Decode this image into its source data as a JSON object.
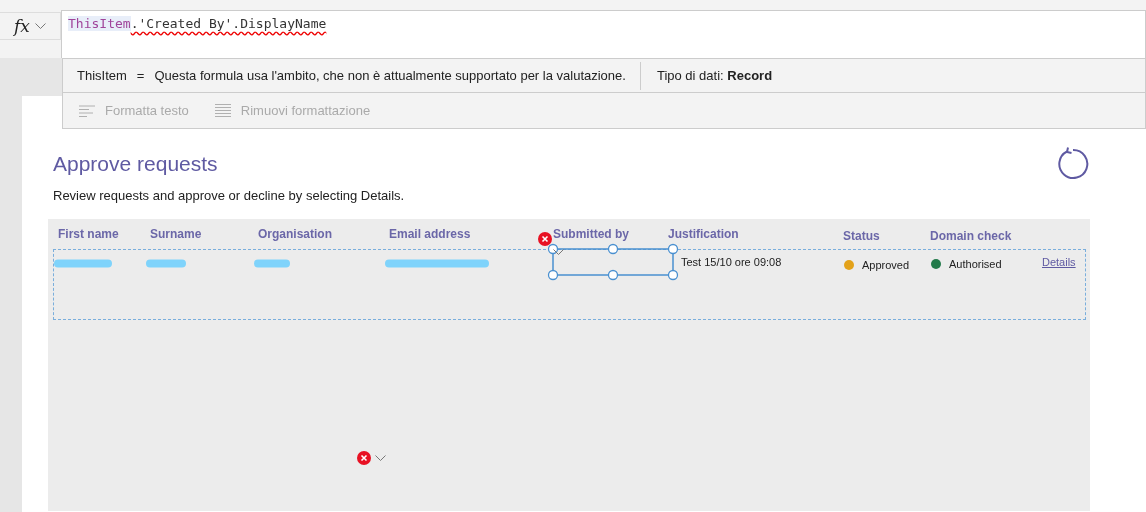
{
  "formula_bar": {
    "fx_label": "fx",
    "formula": [
      {
        "kind": "identifier",
        "text": "ThisItem"
      },
      {
        "kind": "error",
        "text": ".'Created By'.DisplayName"
      }
    ]
  },
  "intellisense": {
    "expression": "ThisItem",
    "operator": "=",
    "message": "Questa formula usa l'ambito, che non è attualmente supportato per la valutazione.",
    "data_type": "Tipo di dati: **Record**"
  },
  "toolbar": [
    {
      "kind": "format",
      "label": "Formatta testo",
      "disabled": true
    },
    {
      "kind": "clear",
      "label": "Rimuovi formattazione",
      "disabled": true
    }
  ],
  "screen": {
    "title": "Approve requests",
    "subtitle": "Review requests and approve or decline by selecting Details.",
    "gallery": {
      "columns": [
        {
          "label": "First name"
        },
        {
          "label": "Surname"
        },
        {
          "label": "Organisation"
        },
        {
          "label": "Email address"
        },
        {
          "label": "Submitted by"
        },
        {
          "label": "Justification"
        },
        {
          "label": "Status"
        },
        {
          "label": "Domain check"
        }
      ],
      "rows": [
        {
          "selected": true,
          "cells": [
            {
              "kind": "redacted"
            },
            {
              "kind": "redacted"
            },
            {
              "kind": "redacted"
            },
            {
              "kind": "redacted"
            },
            {
              "kind": "control",
              "selected": true,
              "error": true
            },
            {
              "kind": "text",
              "text": "Test 15/10 ore 09:08"
            },
            {
              "kind": "status",
              "text": "Approved",
              "color": "#e3a21a"
            },
            {
              "kind": "status",
              "text": "Authorised",
              "color": "#237b4b"
            },
            {
              "kind": "link",
              "text": "Details"
            }
          ]
        }
      ],
      "stray_error": true
    }
  }
}
